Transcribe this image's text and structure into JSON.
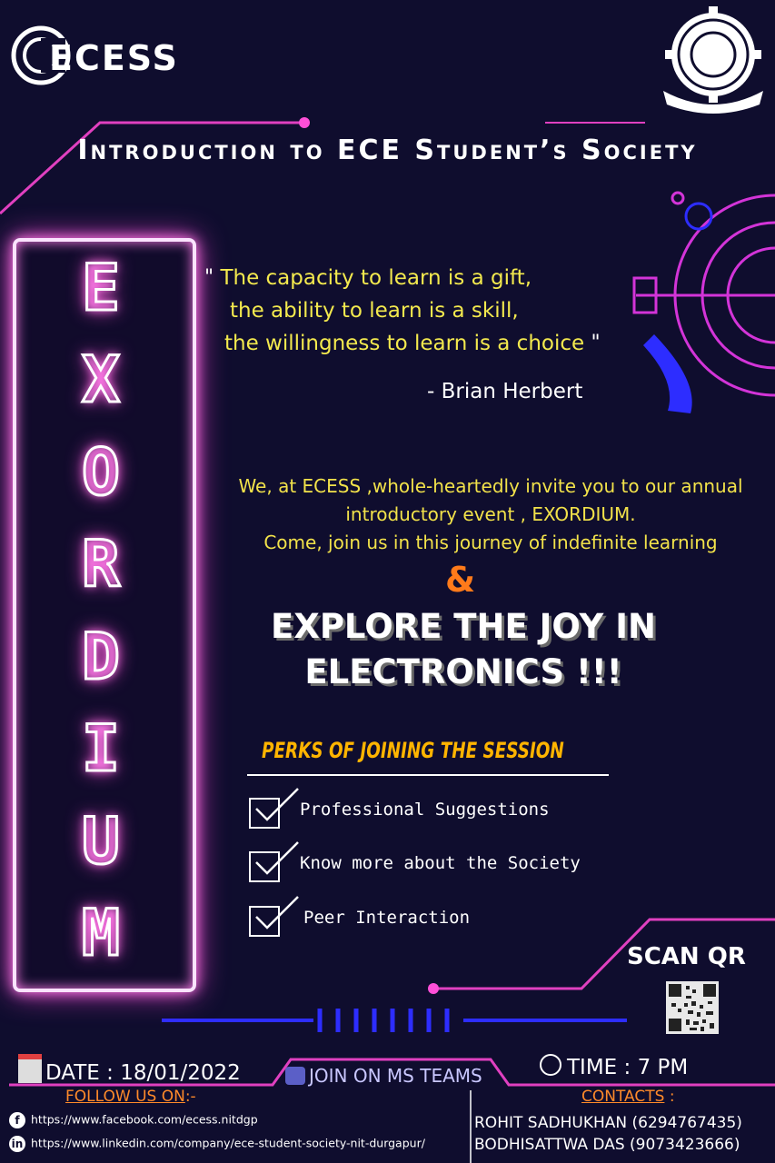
{
  "header": {
    "logo_text": "ECESS",
    "title": "Introduction to ECE Student’s Society"
  },
  "sidebar": {
    "letters": [
      "E",
      "X",
      "O",
      "R",
      "D",
      "I",
      "U",
      "M"
    ]
  },
  "quote": {
    "line1": "The capacity to learn is a gift,",
    "line2": "the ability to learn is a skill,",
    "line3": "the willingness to learn is a choice",
    "author": "- Brian Herbert"
  },
  "invite": {
    "line1": "We, at ECESS ,whole-heartedly invite you to our annual",
    "line2": "introductory event , EXORDIUM.",
    "line3": "Come, join us in this journey of indefinite learning",
    "ampersand": "&",
    "headline1": "EXPLORE THE JOY IN",
    "headline2": "ELECTRONICS !!!"
  },
  "perks": {
    "title": "PERKS OF JOINING THE SESSION",
    "items": [
      "Professional Suggestions",
      "Know more about the Society",
      "Peer Interaction"
    ]
  },
  "scan": {
    "label": "SCAN QR"
  },
  "event": {
    "date": "DATE : 18/01/2022",
    "time": "TIME : 7 PM",
    "teams": "JOIN ON MS TEAMS"
  },
  "follow": {
    "label": "FOLLOW US ON",
    "suffix": ":-",
    "facebook": "https://www.facebook.com/ecess.nitdgp",
    "linkedin": "https://www.linkedin.com/company/ece-student-society-nit-durgapur/"
  },
  "contacts": {
    "label": "CONTACTS",
    "suffix": " :",
    "people": [
      "ROHIT SADHUKHAN (6294767435)",
      "BODHISATTWA DAS (9073423666)"
    ]
  },
  "colors": {
    "background": "#0f0d2e",
    "magenta": "#e040c0",
    "quote_yellow": "#f3e94e",
    "perk_orange": "#ffb400",
    "blue": "#2d2dff"
  }
}
